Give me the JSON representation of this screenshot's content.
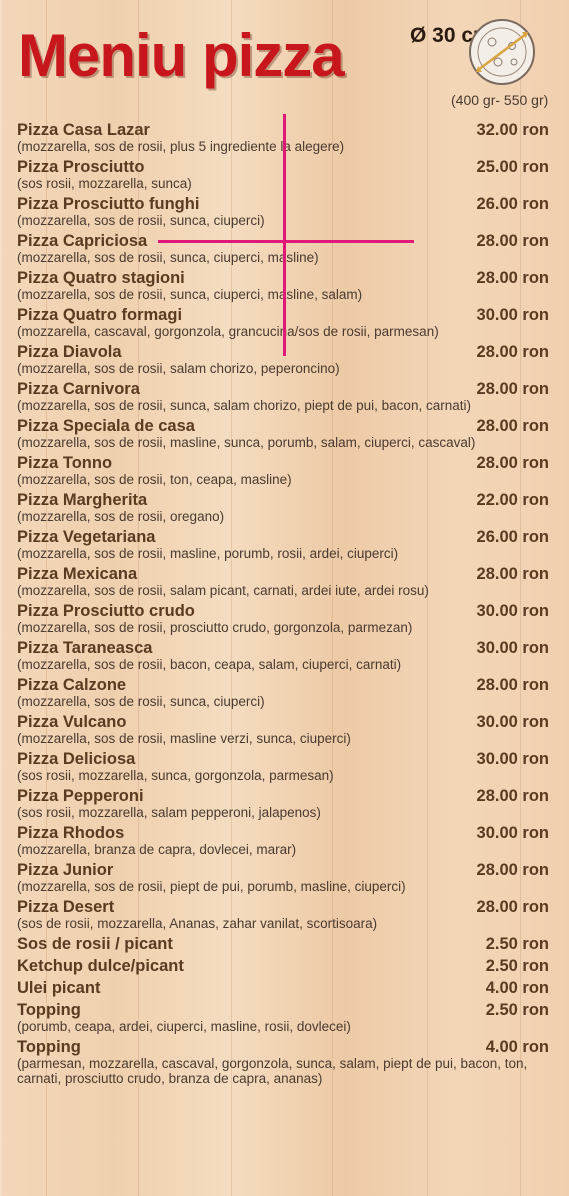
{
  "header": {
    "title": "Meniu pizza",
    "size": "Ø 30 cm",
    "weight": "(400 gr- 550 gr)",
    "icon": "pizza-icon"
  },
  "colors": {
    "title": "#c8161d",
    "text": "#5b3a22",
    "cursor": "#e0187a"
  },
  "items": [
    {
      "name": "Pizza Casa Lazar",
      "desc": "(mozzarella, sos de rosii, plus 5 ingrediente la alegere)",
      "price": "32.00 ron"
    },
    {
      "name": "Pizza Prosciutto",
      "desc": "(sos rosii, mozzarella, sunca)",
      "price": "25.00 ron"
    },
    {
      "name": "Pizza Prosciutto funghi",
      "desc": "(mozzarella, sos de rosii, sunca, ciuperci)",
      "price": "26.00 ron"
    },
    {
      "name": "Pizza Capriciosa",
      "desc": "(mozzarella, sos de rosii, sunca, ciuperci, masline)",
      "price": "28.00 ron"
    },
    {
      "name": "Pizza Quatro stagioni",
      "desc": "(mozzarella, sos de rosii, sunca, ciuperci, masline, salam)",
      "price": "28.00 ron"
    },
    {
      "name": "Pizza Quatro formagi",
      "desc": "(mozzarella, cascaval, gorgonzola, grancucina/sos de rosii, parmesan)",
      "price": "30.00 ron"
    },
    {
      "name": "Pizza Diavola",
      "desc": "(mozzarella, sos de rosii, salam chorizo, peperoncino)",
      "price": "28.00 ron"
    },
    {
      "name": "Pizza Carnivora",
      "desc": "(mozzarella, sos de rosii, sunca, salam chorizo, piept de pui, bacon, carnati)",
      "price": "28.00 ron"
    },
    {
      "name": "Pizza Speciala de casa",
      "desc": "(mozzarella, sos de rosii, masline, sunca, porumb, salam, ciuperci, cascaval)",
      "price": "28.00 ron"
    },
    {
      "name": "Pizza Tonno",
      "desc": "(mozzarella, sos de rosii, ton, ceapa, masline)",
      "price": "28.00 ron"
    },
    {
      "name": "Pizza Margherita",
      "desc": "(mozzarella, sos de rosii, oregano)",
      "price": "22.00 ron"
    },
    {
      "name": "Pizza Vegetariana",
      "desc": "(mozzarella, sos de rosii, masline, porumb, rosii, ardei, ciuperci)",
      "price": "26.00 ron"
    },
    {
      "name": "Pizza Mexicana",
      "desc": "(mozzarella, sos de rosii, salam picant, carnati, ardei iute, ardei rosu)",
      "price": "28.00 ron"
    },
    {
      "name": "Pizza Prosciutto crudo",
      "desc": "(mozzarella, sos de rosii, prosciutto crudo, gorgonzola, parmezan)",
      "price": "30.00 ron"
    },
    {
      "name": "Pizza Taraneasca",
      "desc": "(mozzarella, sos de rosii, bacon, ceapa, salam, ciuperci, carnati)",
      "price": "30.00 ron"
    },
    {
      "name": "Pizza Calzone",
      "desc": "(mozzarella, sos de rosii, sunca, ciuperci)",
      "price": "28.00 ron"
    },
    {
      "name": "Pizza Vulcano",
      "desc": "(mozzarella, sos de rosii, masline verzi, sunca, ciuperci)",
      "price": "30.00 ron"
    },
    {
      "name": "Pizza Deliciosa",
      "desc": "(sos rosii, mozzarella, sunca, gorgonzola, parmesan)",
      "price": "30.00 ron"
    },
    {
      "name": "Pizza Pepperoni",
      "desc": "(sos rosii, mozzarella, salam pepperoni, jalapenos)",
      "price": "28.00 ron"
    },
    {
      "name": "Pizza Rhodos",
      "desc": "(mozzarella, branza de capra, dovlecei, marar)",
      "price": "30.00 ron"
    },
    {
      "name": "Pizza Junior",
      "desc": "(mozzarella, sos de rosii, piept de pui, porumb, masline, ciuperci)",
      "price": "28.00 ron"
    },
    {
      "name": "Pizza Desert",
      "desc": "(sos de rosii, mozzarella, Ananas, zahar vanilat, scortisoara)",
      "price": "28.00 ron"
    }
  ],
  "extras": [
    {
      "name": "Sos de rosii / picant",
      "price": "2.50 ron"
    },
    {
      "name": "Ketchup dulce/picant",
      "price": "2.50 ron"
    },
    {
      "name": "Ulei picant",
      "price": "4.00 ron"
    }
  ],
  "toppings": [
    {
      "name": "Topping",
      "desc": "(porumb, ceapa, ardei, ciuperci, masline, rosii, dovlecei)",
      "price": "2.50 ron"
    },
    {
      "name": "Topping",
      "desc": "(parmesan, mozzarella, cascaval, gorgonzola, sunca, salam, piept de pui, bacon, ton, carnati, prosciutto crudo, branza de capra, ananas)",
      "price": "4.00 ron"
    }
  ]
}
